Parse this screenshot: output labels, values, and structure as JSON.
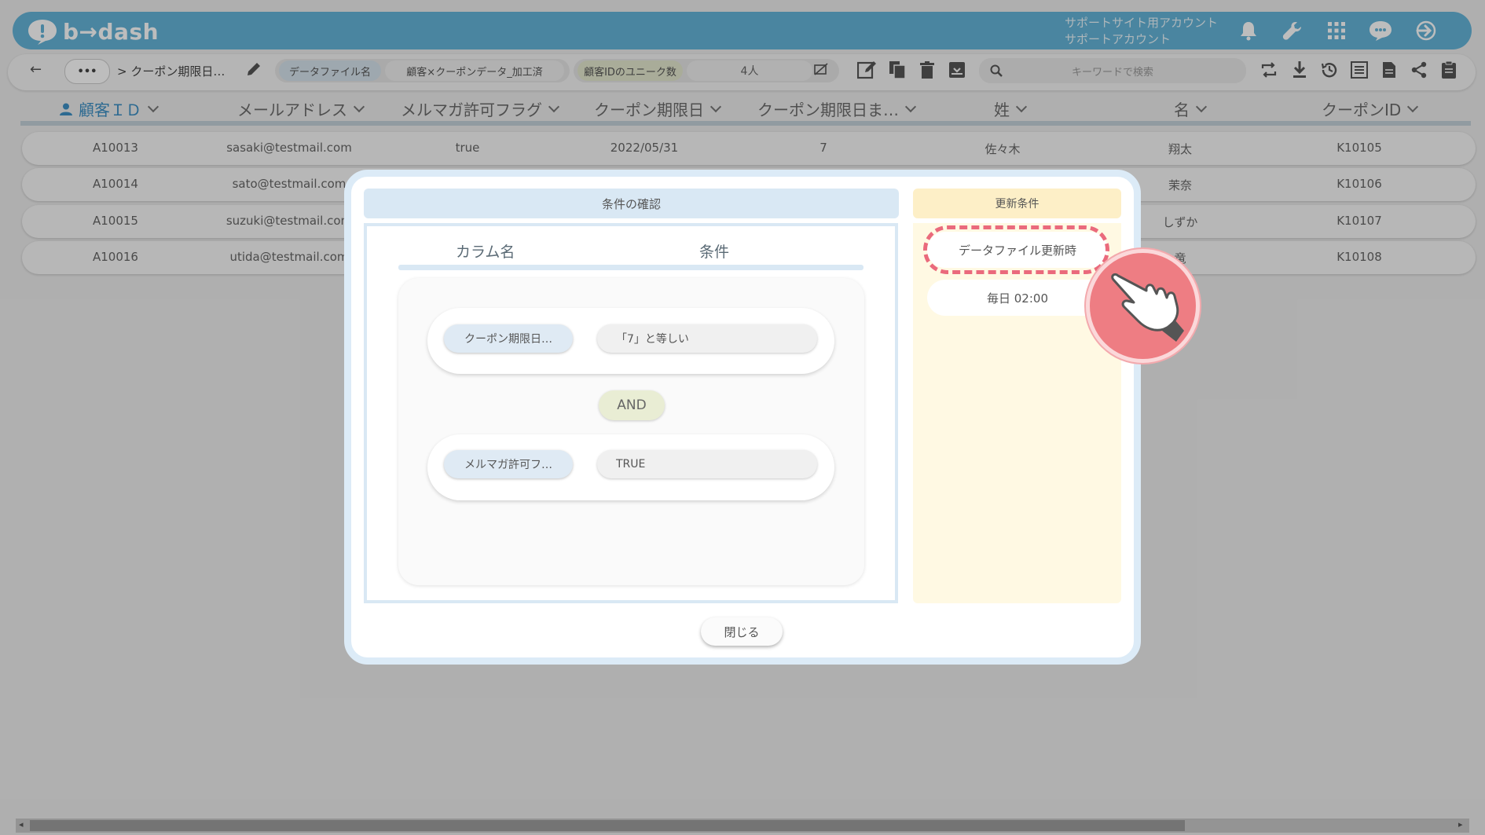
{
  "header": {
    "logo_text": "b→dash",
    "account_line1": "サポートサイト用アカウント",
    "account_line2": "サポートアカウント",
    "icons": [
      "bell-icon",
      "wrench-icon",
      "apps-grid-icon",
      "chat-icon",
      "logout-icon"
    ]
  },
  "toolbar": {
    "more_label": "•••",
    "breadcrumb": "> クーポン期限日…",
    "datafile_label": "データファイル名",
    "datafile_value": "顧客×クーポンデータ_加工済",
    "unique_label": "顧客IDのユニーク数",
    "unique_value": "4人",
    "search_placeholder": "キーワードで検索"
  },
  "table": {
    "columns": [
      "顧客ＩＤ",
      "メールアドレス",
      "メルマガ許可フラグ",
      "クーポン期限日",
      "クーポン期限日ま…",
      "姓",
      "名",
      "クーポンID"
    ],
    "rows": [
      [
        "A10013",
        "sasaki@testmail.com",
        "true",
        "2022/05/31",
        "7",
        "佐々木",
        "翔太",
        "K10105"
      ],
      [
        "A10014",
        "sato@testmail.com",
        "",
        "",
        "",
        "",
        "茉奈",
        "K10106"
      ],
      [
        "A10015",
        "suzuki@testmail.com",
        "",
        "",
        "",
        "",
        "しずか",
        "K10107"
      ],
      [
        "A10016",
        "utida@testmail.com",
        "",
        "",
        "",
        "",
        "竜",
        "K10108"
      ]
    ]
  },
  "modal": {
    "left_title": "条件の確認",
    "col_name_header": "カラム名",
    "condition_header": "条件",
    "conditions": [
      {
        "column": "クーポン期限日…",
        "condition": "「7」と等しい"
      },
      {
        "column": "メルマガ許可フ…",
        "condition": "TRUE"
      }
    ],
    "operator": "AND",
    "right_title": "更新条件",
    "update_options": [
      "データファイル更新時",
      "毎日 02:00"
    ],
    "close_label": "閉じる"
  },
  "colors": {
    "header_blue": "#64b4d8",
    "accent_blue": "#3d8fc4",
    "highlight_red": "#ea6a7c",
    "update_panel": "#fff9e3"
  }
}
